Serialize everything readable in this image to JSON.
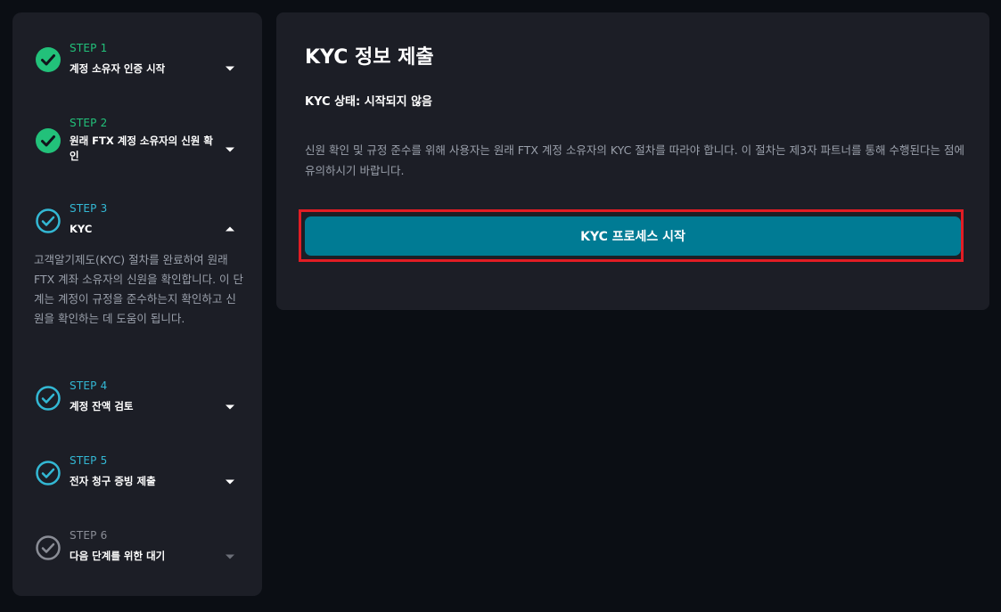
{
  "sidebar": {
    "steps": [
      {
        "num": "STEP 1",
        "title": "계정 소유자 인증 시작",
        "state": "done",
        "expanded": false,
        "icon": "check-circle-filled-icon",
        "caret": "chevron-down-icon"
      },
      {
        "num": "STEP 2",
        "title": "원래 FTX 계정 소유자의 신원 확인",
        "state": "done",
        "expanded": false,
        "icon": "check-circle-filled-icon",
        "caret": "chevron-down-icon"
      },
      {
        "num": "STEP 3",
        "title": "KYC",
        "state": "active",
        "expanded": true,
        "icon": "check-circle-outline-icon",
        "caret": "chevron-up-icon",
        "description": "고객알기제도(KYC) 절차를 완료하여 원래 FTX 계좌 소유자의 신원을 확인합니다. 이 단계는 계정이 규정을 준수하는지 확인하고 신원을 확인하는 데 도움이 됩니다."
      },
      {
        "num": "STEP 4",
        "title": "계정 잔액 검토",
        "state": "pending",
        "expanded": false,
        "icon": "check-circle-outline-icon",
        "caret": "chevron-down-icon"
      },
      {
        "num": "STEP 5",
        "title": "전자 청구 증빙 제출",
        "state": "pending",
        "expanded": false,
        "icon": "check-circle-outline-icon",
        "caret": "chevron-down-icon"
      },
      {
        "num": "STEP 6",
        "title": "다음 단계를 위한 대기",
        "state": "disabled",
        "expanded": false,
        "icon": "check-circle-outline-icon",
        "caret": "chevron-down-icon"
      }
    ]
  },
  "main": {
    "heading": "KYC 정보 제출",
    "status": "KYC 상태: 시작되지 않음",
    "info": "신원 확인 및 규정 준수를 위해 사용자는 원래 FTX 계정 소유자의 KYC 절차를 따라야 합니다. 이 절차는 제3자 파트너를 통해 수행된다는 점에 유의하시기 바랍니다.",
    "start_button": "KYC 프로세스 시작"
  },
  "colors": {
    "done": "#22c17a",
    "active": "#33b8d4",
    "disabled": "#8a8d96",
    "button": "#007b94",
    "highlight": "#e11d24",
    "panel": "#1c1e26",
    "background": "#0b0e14"
  }
}
